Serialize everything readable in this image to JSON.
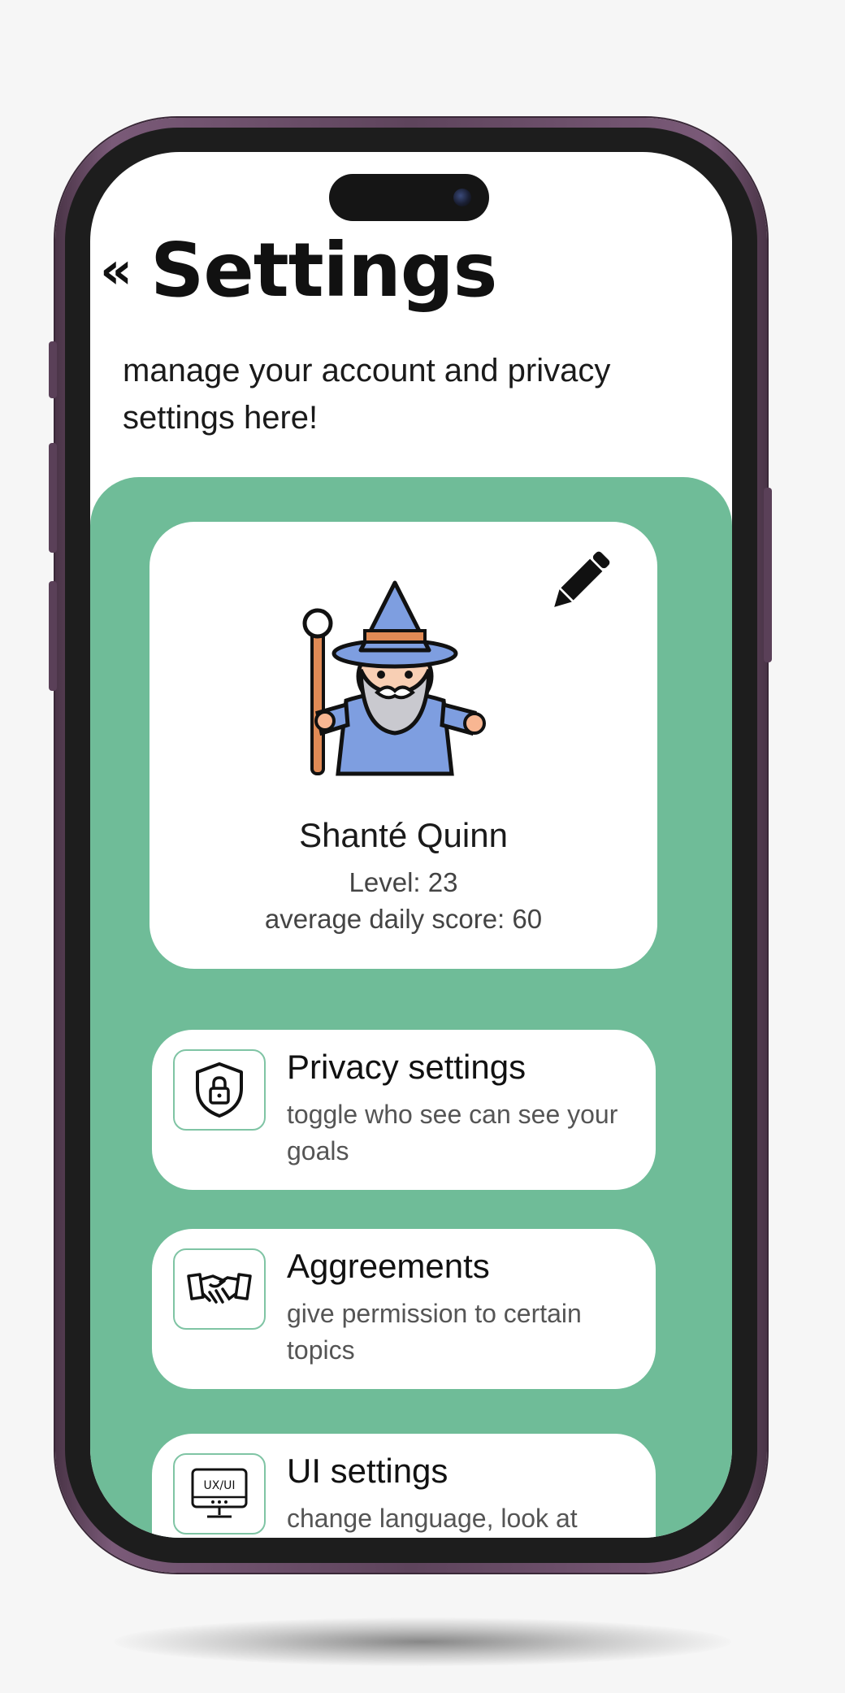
{
  "header": {
    "back_glyph": "«",
    "title": "Settings",
    "subtitle": "manage your account and privacy settings here!"
  },
  "profile": {
    "name": "Shanté Quinn",
    "level": "Level: 23",
    "score": "average daily score: 60",
    "avatar_icon": "wizard-avatar",
    "edit_icon": "pencil-icon"
  },
  "settings": [
    {
      "title": "Privacy settings",
      "description": "toggle who see can see your goals",
      "icon": "shield-lock-icon"
    },
    {
      "title": "Aggreements",
      "description": "give permission to certain topics",
      "icon": "handshake-icon"
    },
    {
      "title": "UI settings",
      "description": "change language, look at",
      "icon": "ux-ui-monitor-icon",
      "icon_text": "UX/UI"
    }
  ],
  "colors": {
    "accent_green": "#6fbc98",
    "card_bg": "#ffffff",
    "phone_frame": "#5e445c"
  }
}
